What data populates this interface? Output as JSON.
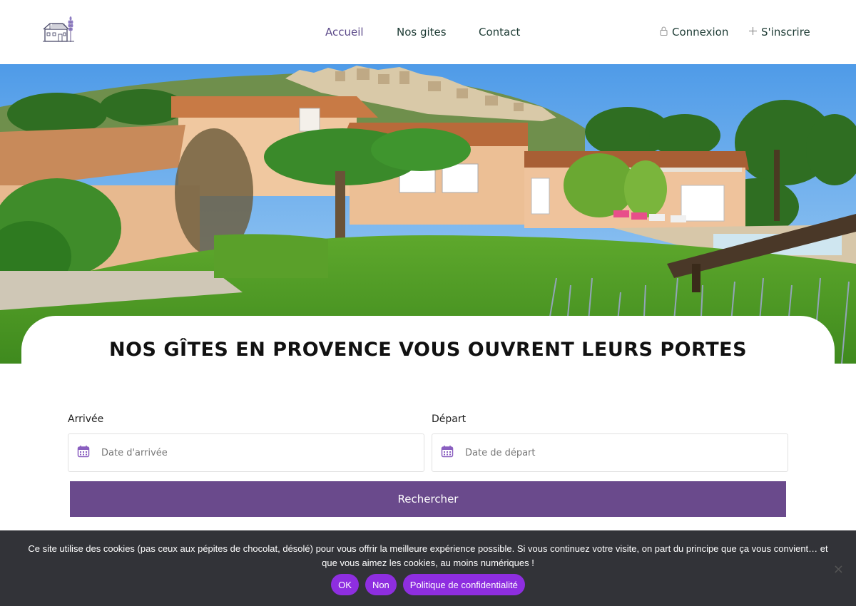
{
  "header": {
    "logo_icon": "house-lavender-logo",
    "nav": [
      {
        "label": "Accueil",
        "active": true
      },
      {
        "label": "Nos gites",
        "active": false
      },
      {
        "label": "Contact",
        "active": false
      }
    ],
    "auth": {
      "login_label": "Connexion",
      "login_icon": "lock-icon",
      "signup_label": "S'inscrire",
      "signup_icon": "plus-icon"
    }
  },
  "hero": {
    "image": "provence-villa-photo"
  },
  "headline": "NOS GÎTES EN PROVENCE VOUS OUVRENT LEURS PORTES",
  "search": {
    "arrival_label": "Arrivée",
    "arrival_placeholder": "Date d'arrivée",
    "departure_label": "Départ",
    "departure_placeholder": "Date de départ",
    "calendar_icon": "calendar-icon",
    "submit_label": "Rechercher"
  },
  "cookie": {
    "text": "Ce site utilise des cookies (pas ceux aux pépites de chocolat, désolé) pour vous offrir la meilleure expérience possible. Si vous continuez votre visite, on part du principe que ça vous convient… et que vous aimez les cookies, au moins numériques !",
    "ok_label": "OK",
    "no_label": "Non",
    "policy_label": "Politique de confidentialité",
    "close_label": "×"
  },
  "colors": {
    "primary": "#6a4a8c",
    "nav_active": "#5c4a8a",
    "cookie_bg": "#323338",
    "cookie_button": "#8e2ee0"
  }
}
